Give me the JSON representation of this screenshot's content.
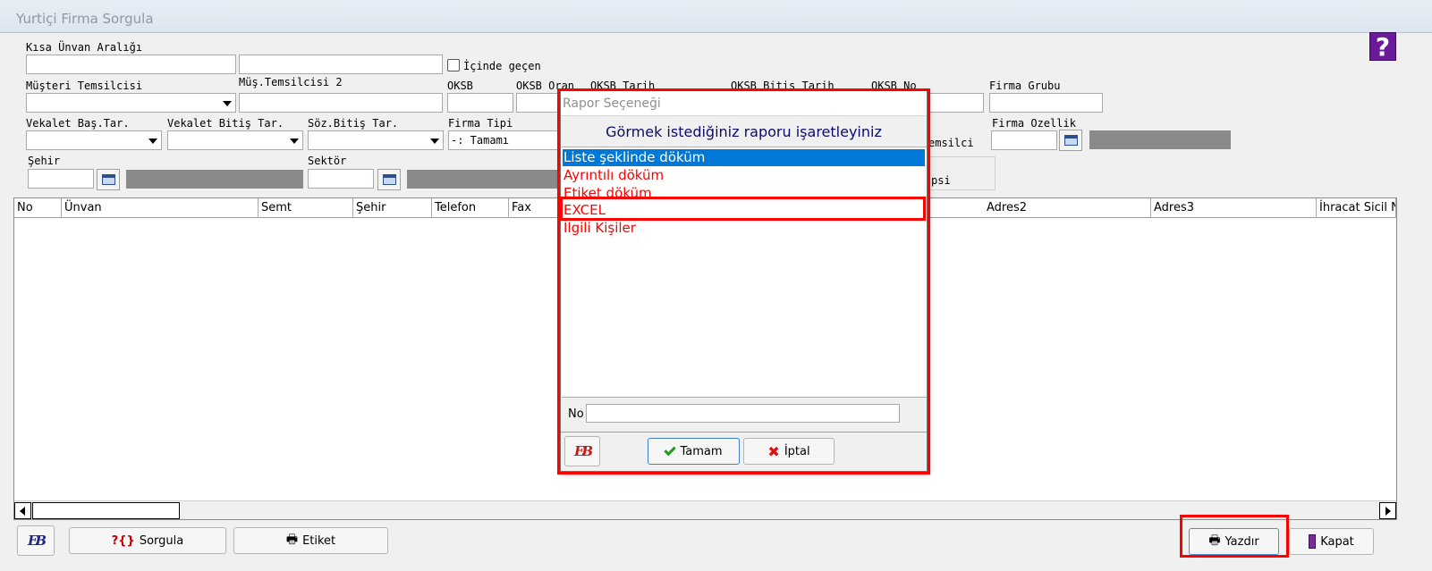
{
  "window": {
    "title": "Yurtiçi Firma Sorgula"
  },
  "help_icon": "?",
  "form": {
    "kisa_unvan_label": "Kısa Ünvan Aralığı",
    "icinde_gecen_label": "İçinde geçen",
    "musteri_temsilcisi_label": "Müşteri Temsilcisi",
    "mus_temsilcisi2_label": "Müş.Temsilcisi 2",
    "oksb_label": "OKSB",
    "oksb_oran_label": "OKSB Oran",
    "oksb_tarih_label": "OKSB Tarih",
    "oksb_bitis_tarih_label": "OKSB Bitiş Tarih",
    "oksb_no_label": "OKSB No",
    "firma_grubu_label": "Firma Grubu",
    "vekalet_bas_label": "Vekalet  Baş.Tar.",
    "vekalet_bitis_label": "Vekalet Bitiş Tar.",
    "soz_bitis_label": "Söz.Bitiş Tar.",
    "firma_tipi_label": "Firma Tipi",
    "firma_tipi_value": "-: Tamamı",
    "emsilci_fragment": "emsilci",
    "firma_ozellik_label": "Firma Ozellik",
    "sehir_label": "Şehir",
    "sektor_label": "Sektör",
    "psi_fragment": "psi"
  },
  "grid": {
    "columns": [
      "No",
      "Ünvan",
      "Semt",
      "Şehir",
      "Telefon",
      "Fax",
      "Adres2",
      "Adres3",
      "İhracat Sicil No"
    ]
  },
  "toolbar": {
    "sorgula_label": "Sorgula",
    "etiket_label": "Etiket",
    "yazdir_label": "Yazdır",
    "kapat_label": "Kapat",
    "logo_text": "EB"
  },
  "dialog": {
    "title": "Rapor Seçeneği",
    "heading": "Görmek istediğiniz raporu işaretleyiniz",
    "options": [
      "Liste şeklinde döküm",
      "Ayrıntılı döküm",
      "Etiket döküm",
      "EXCEL",
      "İlgili Kişiler"
    ],
    "selected_index": 0,
    "no_label": "No",
    "tamam_label": "Tamam",
    "iptal_label": "İptal",
    "logo_text": "EB"
  },
  "colors": {
    "highlight": "#ff0000",
    "selection": "#0078d7",
    "heading": "#0c0c6a"
  }
}
